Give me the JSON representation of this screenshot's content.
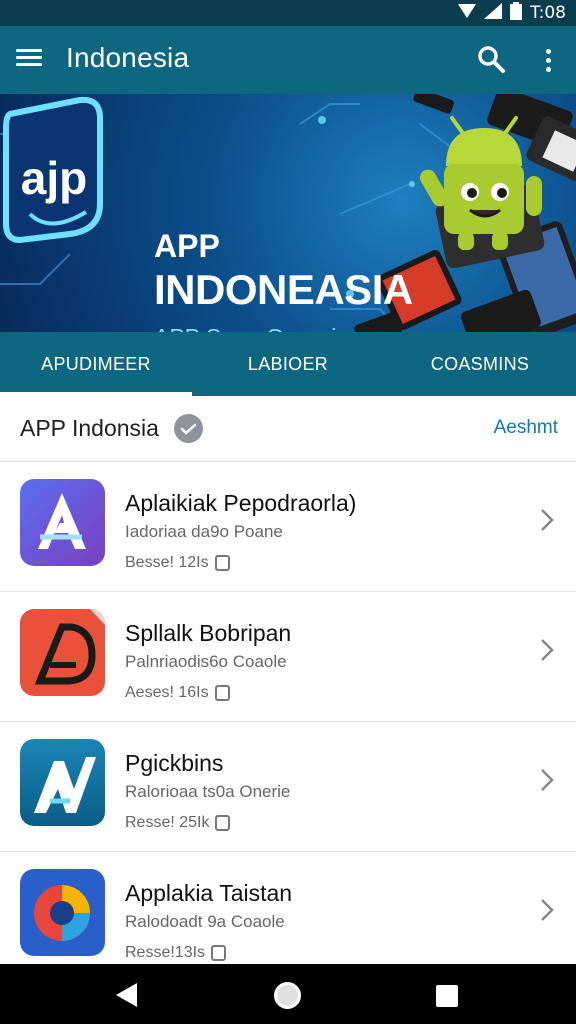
{
  "status_bar": {
    "time": "T:08"
  },
  "app_bar": {
    "title": "Indonesia",
    "icons": [
      "menu-icon",
      "search-icon",
      "more-vert-icon"
    ]
  },
  "banner": {
    "logo_text": "ajp",
    "line1": "APP",
    "line2": "INDONEASIA",
    "line3": "APP Sppp Grermia"
  },
  "tabs": [
    {
      "label": "APUDIMEER",
      "active": true
    },
    {
      "label": "LABIOER",
      "active": false
    },
    {
      "label": "COASMINS",
      "active": false
    }
  ],
  "section": {
    "title": "APP Indonsia",
    "action": "Aeshmt"
  },
  "apps": [
    {
      "name": "Aplaikiak Pepodraorla)",
      "subtitle": "Iadoriaa da9o Poane",
      "meta": "Besse! 12Is",
      "icon": "a-logo-icon"
    },
    {
      "name": "Spllalk Bobripan",
      "subtitle": "Palnriaodis6o Coaole",
      "meta": "Aeses! 16Is",
      "icon": "d-logo-icon"
    },
    {
      "name": "Pgickbins",
      "subtitle": "Ralorioaa ts0a Onerie",
      "meta": "Resse! 25Ik",
      "icon": "n-logo-icon"
    },
    {
      "name": "Applakia Taistan",
      "subtitle": "Ralodoadt 9a Coaole",
      "meta": "Resse!13Is",
      "icon": "circle-logo-icon"
    }
  ],
  "colors": {
    "status_bar": "#0a3e4f",
    "app_bar": "#0e6781",
    "link": "#0b7bb5"
  }
}
